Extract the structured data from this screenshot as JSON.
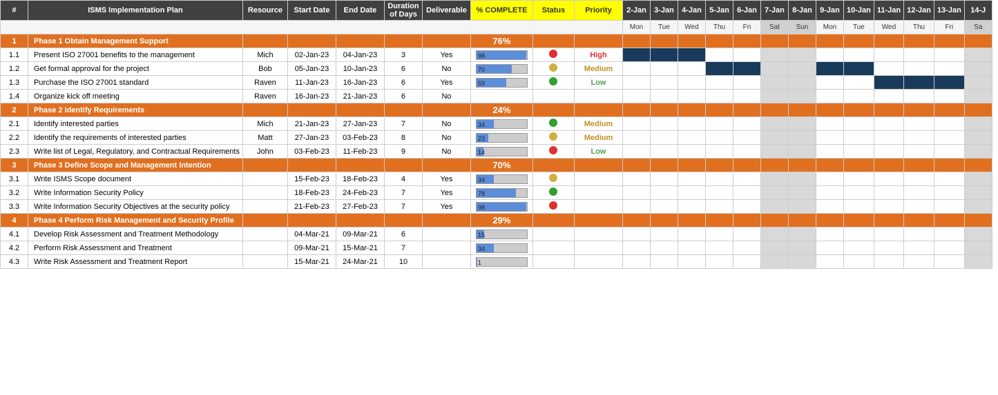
{
  "columns": {
    "fixed": [
      "#",
      "ISMS Implementation Plan",
      "Resource",
      "Start Date",
      "End Date",
      "Duration\nof Days",
      "Deliverable",
      "% COMPLETE",
      "Status",
      "Priority"
    ],
    "gantt_dates": [
      "2-Jan",
      "3-Jan",
      "4-Jan",
      "5-Jan",
      "6-Jan",
      "7-Jan",
      "8-Jan",
      "9-Jan",
      "10-Jan",
      "11-Jan",
      "12-Jan",
      "13-Jan",
      "14-J"
    ],
    "gantt_days": [
      "Mon",
      "Tue",
      "Wed",
      "Thu",
      "Fri",
      "Sat",
      "Sun",
      "Mon",
      "Tue",
      "Wed",
      "Thu",
      "Fri",
      "Sa"
    ]
  },
  "rows": [
    {
      "type": "phase",
      "num": "1",
      "name": "Phase 1 Obtain Management Support",
      "resource": "",
      "start": "",
      "end": "",
      "duration": "",
      "deliverable": "",
      "complete": 76,
      "status": "",
      "priority": "",
      "gantt": [
        "e",
        "e",
        "e",
        "e",
        "e",
        "e",
        "e",
        "e",
        "e",
        "e",
        "e",
        "e",
        "e"
      ]
    },
    {
      "type": "data",
      "num": "1.1",
      "name": "Present ISO 27001 benefits to the management",
      "resource": "Mich",
      "start": "02-Jan-23",
      "end": "04-Jan-23",
      "duration": "3",
      "deliverable": "Yes",
      "complete": 98,
      "status": "red",
      "priority": "High",
      "gantt": [
        "d",
        "d",
        "d",
        "e",
        "e",
        "e",
        "e",
        "e",
        "e",
        "e",
        "e",
        "e",
        "e"
      ]
    },
    {
      "type": "data",
      "num": "1.2",
      "name": "Get formal approval for the project",
      "resource": "Bob",
      "start": "05-Jan-23",
      "end": "10-Jan-23",
      "duration": "6",
      "deliverable": "No",
      "complete": 70,
      "status": "yellow",
      "priority": "Medium",
      "gantt": [
        "e",
        "e",
        "e",
        "d",
        "d",
        "e",
        "e",
        "d",
        "d",
        "e",
        "e",
        "e",
        "e"
      ]
    },
    {
      "type": "data",
      "num": "1.3",
      "name": "Purchase the ISO 27001 standard",
      "resource": "Raven",
      "start": "11-Jan-23",
      "end": "16-Jan-23",
      "duration": "6",
      "deliverable": "Yes",
      "complete": 59,
      "status": "green",
      "priority": "Low",
      "gantt": [
        "e",
        "e",
        "e",
        "e",
        "e",
        "e",
        "e",
        "e",
        "e",
        "d",
        "d",
        "d",
        "e"
      ]
    },
    {
      "type": "data",
      "num": "1.4",
      "name": "Organize kick off meeting",
      "resource": "Raven",
      "start": "16-Jan-23",
      "end": "21-Jan-23",
      "duration": "6",
      "deliverable": "No",
      "complete": 0,
      "status": "",
      "priority": "",
      "gantt": [
        "e",
        "e",
        "e",
        "e",
        "e",
        "e",
        "e",
        "e",
        "e",
        "e",
        "e",
        "e",
        "e"
      ]
    },
    {
      "type": "phase",
      "num": "2",
      "name": "Phase 2 Identify Requirements",
      "resource": "",
      "start": "",
      "end": "",
      "duration": "",
      "deliverable": "",
      "complete": 24,
      "status": "",
      "priority": "",
      "gantt": [
        "e",
        "e",
        "e",
        "e",
        "e",
        "e",
        "e",
        "e",
        "e",
        "e",
        "e",
        "e",
        "e"
      ]
    },
    {
      "type": "data",
      "num": "2.1",
      "name": "Identify interested parties",
      "resource": "Mich",
      "start": "21-Jan-23",
      "end": "27-Jan-23",
      "duration": "7",
      "deliverable": "No",
      "complete": 34,
      "status": "green",
      "priority": "Medium",
      "gantt": [
        "e",
        "e",
        "e",
        "e",
        "e",
        "e",
        "e",
        "e",
        "e",
        "e",
        "e",
        "e",
        "e"
      ]
    },
    {
      "type": "data",
      "num": "2.2",
      "name": "Identify the requirements of interested parties",
      "resource": "Matt",
      "start": "27-Jan-23",
      "end": "03-Feb-23",
      "duration": "8",
      "deliverable": "No",
      "complete": 23,
      "status": "yellow",
      "priority": "Medium",
      "gantt": [
        "e",
        "e",
        "e",
        "e",
        "e",
        "e",
        "e",
        "e",
        "e",
        "e",
        "e",
        "e",
        "e"
      ]
    },
    {
      "type": "data",
      "num": "2.3",
      "name": "Write list of Legal, Regulatory, and Contractual Requirements",
      "resource": "John",
      "start": "03-Feb-23",
      "end": "11-Feb-23",
      "duration": "9",
      "deliverable": "No",
      "complete": 14,
      "status": "red",
      "priority": "Low",
      "gantt": [
        "e",
        "e",
        "e",
        "e",
        "e",
        "e",
        "e",
        "e",
        "e",
        "e",
        "e",
        "e",
        "e"
      ]
    },
    {
      "type": "phase",
      "num": "3",
      "name": "Phase 3 Define Scope and Management Intention",
      "resource": "",
      "start": "",
      "end": "",
      "duration": "",
      "deliverable": "",
      "complete": 70,
      "status": "",
      "priority": "",
      "gantt": [
        "e",
        "e",
        "e",
        "e",
        "e",
        "e",
        "e",
        "e",
        "e",
        "e",
        "e",
        "e",
        "e"
      ]
    },
    {
      "type": "data",
      "num": "3.1",
      "name": "Write ISMS Scope document",
      "resource": "",
      "start": "15-Feb-23",
      "end": "18-Feb-23",
      "duration": "4",
      "deliverable": "Yes",
      "complete": 34,
      "status": "yellow",
      "priority": "",
      "gantt": [
        "e",
        "e",
        "e",
        "e",
        "e",
        "e",
        "e",
        "e",
        "e",
        "e",
        "e",
        "e",
        "e"
      ]
    },
    {
      "type": "data",
      "num": "3.2",
      "name": "Write Information Security Policy",
      "resource": "",
      "start": "18-Feb-23",
      "end": "24-Feb-23",
      "duration": "7",
      "deliverable": "Yes",
      "complete": 78,
      "status": "green",
      "priority": "",
      "gantt": [
        "e",
        "e",
        "e",
        "e",
        "e",
        "e",
        "e",
        "e",
        "e",
        "e",
        "e",
        "e",
        "e"
      ]
    },
    {
      "type": "data",
      "num": "3.3",
      "name": "Write Information Security Objectives at the security policy",
      "resource": "",
      "start": "21-Feb-23",
      "end": "27-Feb-23",
      "duration": "7",
      "deliverable": "Yes",
      "complete": 98,
      "status": "red",
      "priority": "",
      "gantt": [
        "e",
        "e",
        "e",
        "e",
        "e",
        "e",
        "e",
        "e",
        "e",
        "e",
        "e",
        "e",
        "e"
      ]
    },
    {
      "type": "phase",
      "num": "4",
      "name": "Phase 4 Perform Risk Management and Security Profile",
      "resource": "",
      "start": "",
      "end": "",
      "duration": "",
      "deliverable": "",
      "complete": 29,
      "status": "",
      "priority": "",
      "gantt": [
        "e",
        "e",
        "e",
        "e",
        "e",
        "e",
        "e",
        "e",
        "e",
        "e",
        "e",
        "e",
        "e"
      ]
    },
    {
      "type": "data",
      "num": "4.1",
      "name": "Develop Risk Assessment and Treatment Methodology",
      "resource": "",
      "start": "04-Mar-21",
      "end": "09-Mar-21",
      "duration": "6",
      "deliverable": "",
      "complete": 15,
      "status": "",
      "priority": "",
      "gantt": [
        "e",
        "e",
        "e",
        "e",
        "e",
        "e",
        "e",
        "e",
        "e",
        "e",
        "e",
        "e",
        "e"
      ]
    },
    {
      "type": "data",
      "num": "4.2",
      "name": "Perform Risk Assessment and Treatment",
      "resource": "",
      "start": "09-Mar-21",
      "end": "15-Mar-21",
      "duration": "7",
      "deliverable": "",
      "complete": 34,
      "status": "",
      "priority": "",
      "gantt": [
        "e",
        "e",
        "e",
        "e",
        "e",
        "e",
        "e",
        "e",
        "e",
        "e",
        "e",
        "e",
        "e"
      ]
    },
    {
      "type": "data",
      "num": "4.3",
      "name": "Write Risk Assessment and Treatment Report",
      "resource": "",
      "start": "15-Mar-21",
      "end": "24-Mar-21",
      "duration": "10",
      "deliverable": "",
      "complete": 1,
      "status": "",
      "priority": "",
      "gantt": [
        "e",
        "e",
        "e",
        "e",
        "e",
        "e",
        "e",
        "e",
        "e",
        "e",
        "e",
        "e",
        "e"
      ]
    }
  ],
  "gantt_config": {
    "row_1_1": [
      "d",
      "d",
      "d",
      "e",
      "e",
      "w",
      "w",
      "e",
      "e",
      "e",
      "e",
      "e",
      "w"
    ],
    "row_1_2": [
      "e",
      "e",
      "e",
      "d",
      "d",
      "w",
      "w",
      "d",
      "d",
      "e",
      "e",
      "e",
      "w"
    ],
    "row_1_3": [
      "e",
      "e",
      "e",
      "e",
      "e",
      "w",
      "w",
      "e",
      "e",
      "d",
      "d",
      "d",
      "w"
    ],
    "row_1_4": [
      "e",
      "e",
      "e",
      "e",
      "e",
      "w",
      "w",
      "e",
      "e",
      "e",
      "e",
      "e",
      "w"
    ]
  }
}
